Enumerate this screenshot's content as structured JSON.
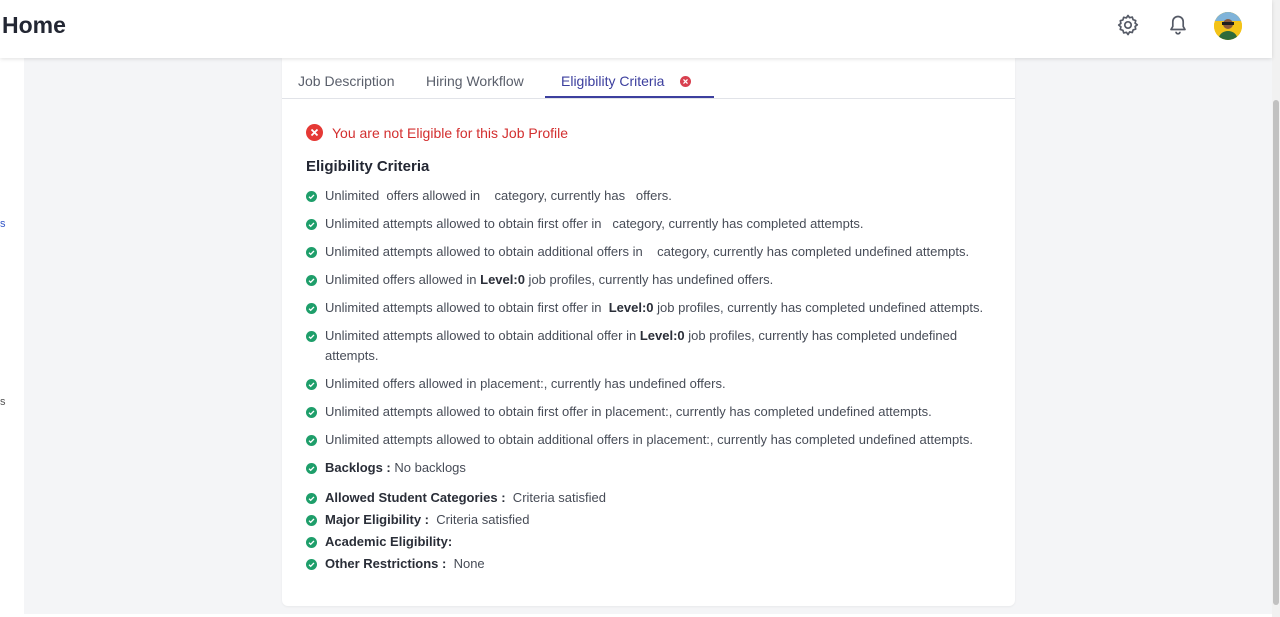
{
  "header": {
    "title": "Home",
    "settings_icon": "gear-icon",
    "notifications_icon": "bell-icon",
    "avatar_icon": "user-avatar"
  },
  "sidebar": {
    "fragment_1": "s",
    "fragment_2": "s"
  },
  "tabs": [
    {
      "label": "Job Description"
    },
    {
      "label": "Hiring Workflow"
    },
    {
      "label": "Eligibility Criteria",
      "active": true
    }
  ],
  "alert": {
    "text": "You are not Eligible for this Job Profile",
    "color": "#d32f2f"
  },
  "section_title": "Eligibility Criteria",
  "criteria": {
    "c1": "Unlimited  offers allowed in    category, currently has   offers.",
    "c2": "Unlimited attempts allowed to obtain first offer in   category, currently has completed attempts.",
    "c3": "Unlimited attempts allowed to obtain additional offers in    category, currently has completed undefined attempts.",
    "c4_pre": "Unlimited offers allowed in ",
    "c4_bold": "Level:0",
    "c4_post": " job profiles, currently has undefined offers.",
    "c5_pre": "Unlimited attempts allowed to obtain first offer in  ",
    "c5_bold": "Level:0",
    "c5_post": " job profiles, currently has completed undefined attempts.",
    "c6_pre": "Unlimited attempts allowed to obtain additional offer in ",
    "c6_bold": "Level:0",
    "c6_post": " job profiles, currently has completed undefined attempts.",
    "c7": "Unlimited offers allowed in placement:, currently has undefined offers.",
    "c8": "Unlimited attempts allowed to obtain first offer in placement:, currently has completed undefined attempts.",
    "c9": "Unlimited attempts allowed to obtain additional offers in placement:, currently has completed undefined attempts.",
    "backlogs_label": "Backlogs :",
    "backlogs_value": " No backlogs",
    "categories_label": "Allowed Student Categories :",
    "categories_value": "  Criteria satisfied",
    "major_label": "Major Eligibility :",
    "major_value": "  Criteria satisfied",
    "academic_label": "Academic Eligibility:",
    "academic_value": "",
    "other_label": "Other Restrictions :",
    "other_value": "  None"
  },
  "colors": {
    "accent": "#3c3f9e",
    "success": "#1e9e6a",
    "error": "#d32f2f"
  }
}
